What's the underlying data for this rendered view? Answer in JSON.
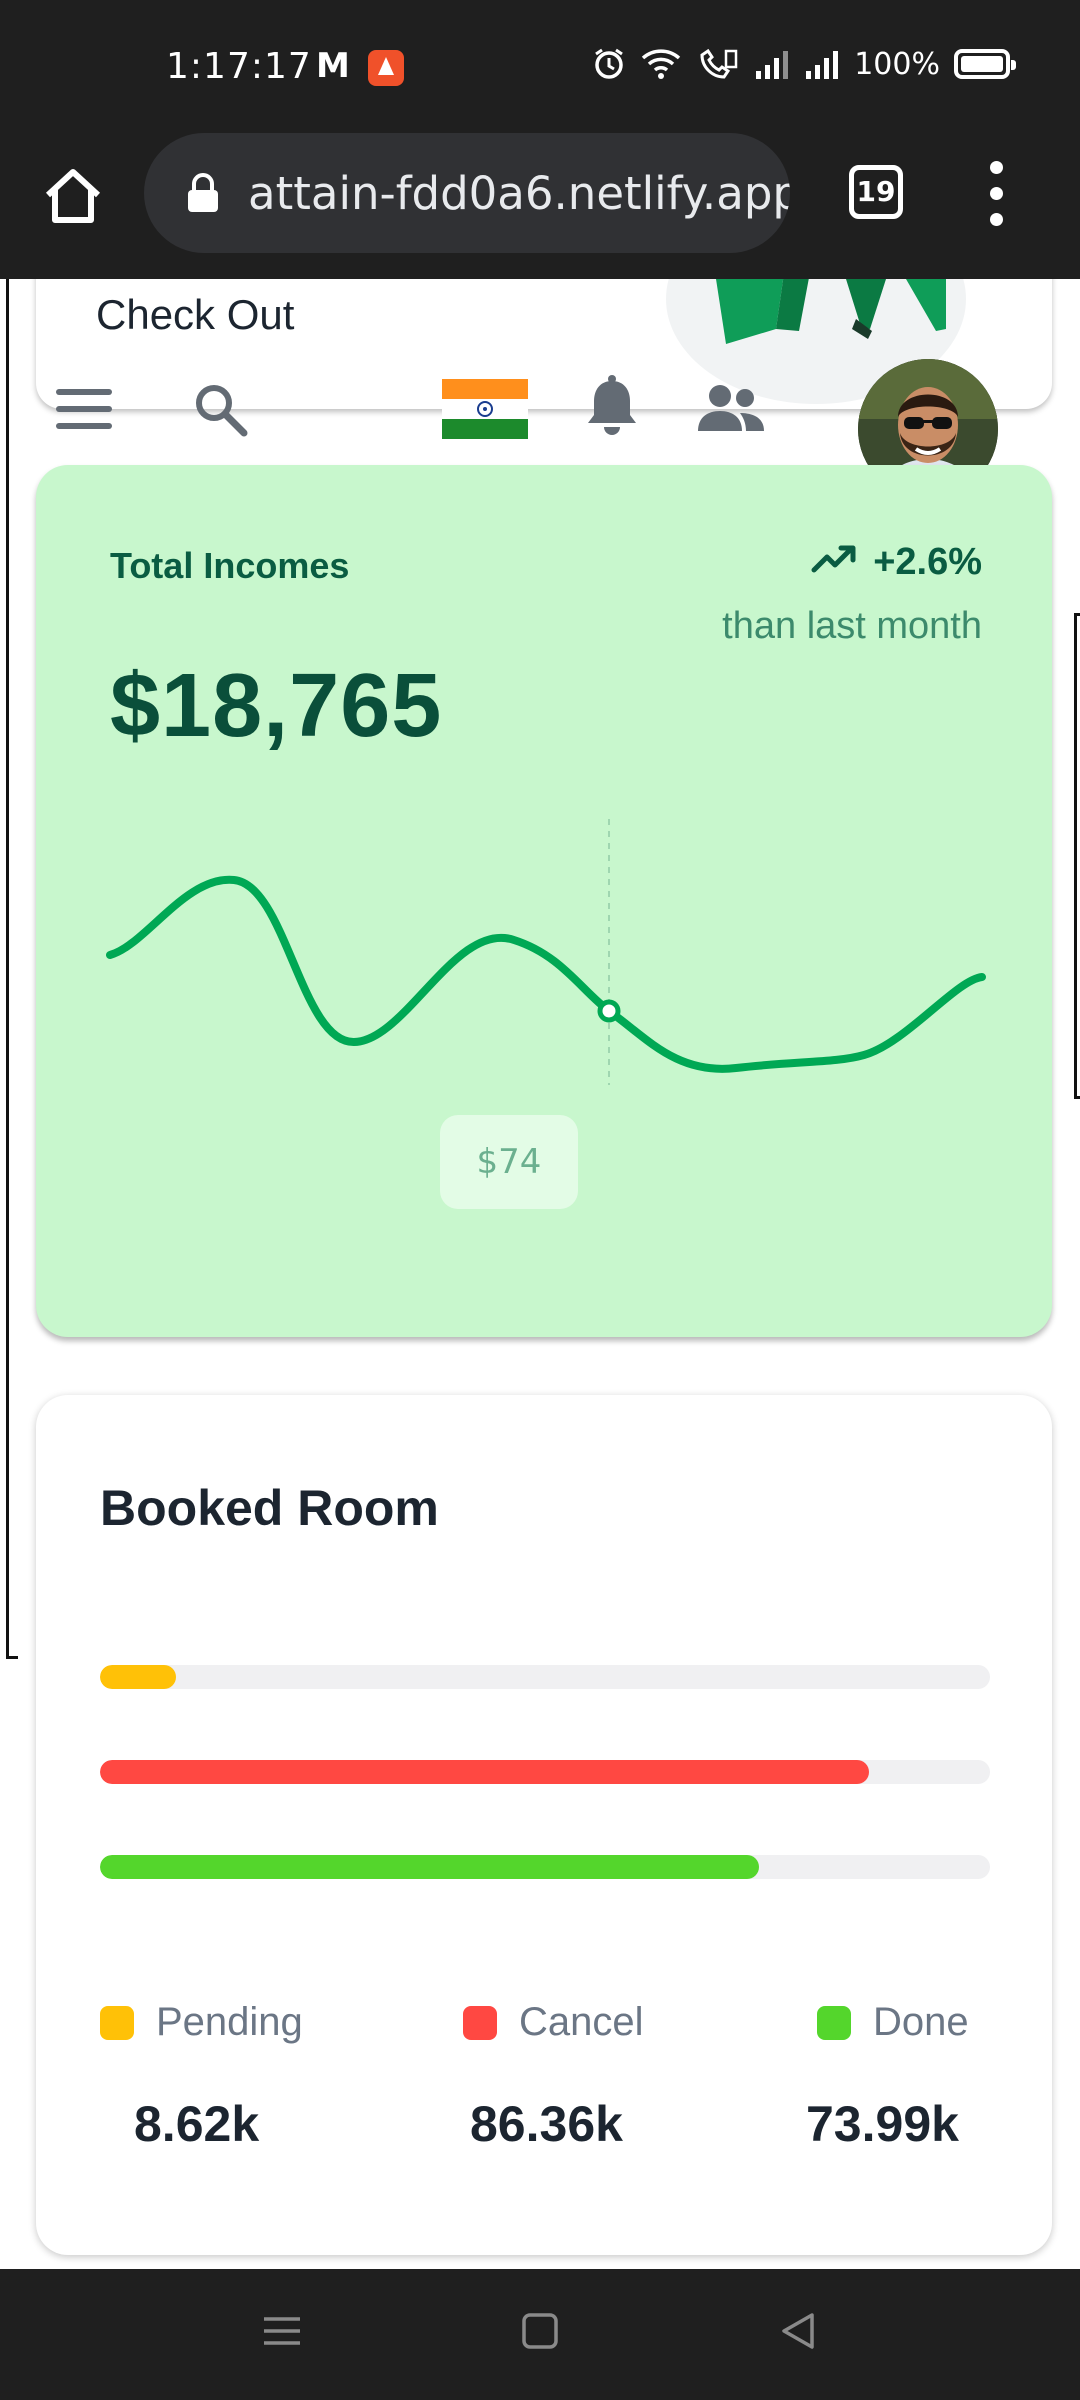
{
  "status_bar": {
    "time": "1:17:17",
    "notification_letter": "M",
    "battery_percent": "100%",
    "icons": [
      "gmail-icon",
      "app-notification-icon",
      "alarm-icon",
      "wifi-icon",
      "volte-icon",
      "signal-icon",
      "signal-icon",
      "battery-icon"
    ]
  },
  "browser": {
    "url": "attain-fdd0a6.netlify.app",
    "tab_count": "19"
  },
  "top_card": {
    "text": "Check Out"
  },
  "navbar": {
    "icons": [
      "menu-icon",
      "search-icon",
      "india-flag-icon",
      "bell-icon",
      "people-icon",
      "avatar"
    ]
  },
  "income_card": {
    "title": "Total Incomes",
    "amount": "$18,765",
    "trend": "+2.6%",
    "trend_caption": "than last month",
    "tooltip_value": "$74",
    "colors": {
      "background": "#c8f7cd",
      "line": "#00a854",
      "text": "#0a5c42"
    }
  },
  "booked_room": {
    "title": "Booked Room",
    "items": [
      {
        "label": "Pending",
        "value": "8.62k",
        "fill_fraction": 0.085,
        "color": "#ffc107"
      },
      {
        "label": "Cancel",
        "value": "86.36k",
        "fill_fraction": 0.864,
        "color": "#ff4842"
      },
      {
        "label": "Done",
        "value": "73.99k",
        "fill_fraction": 0.74,
        "color": "#54d62c"
      }
    ]
  }
}
